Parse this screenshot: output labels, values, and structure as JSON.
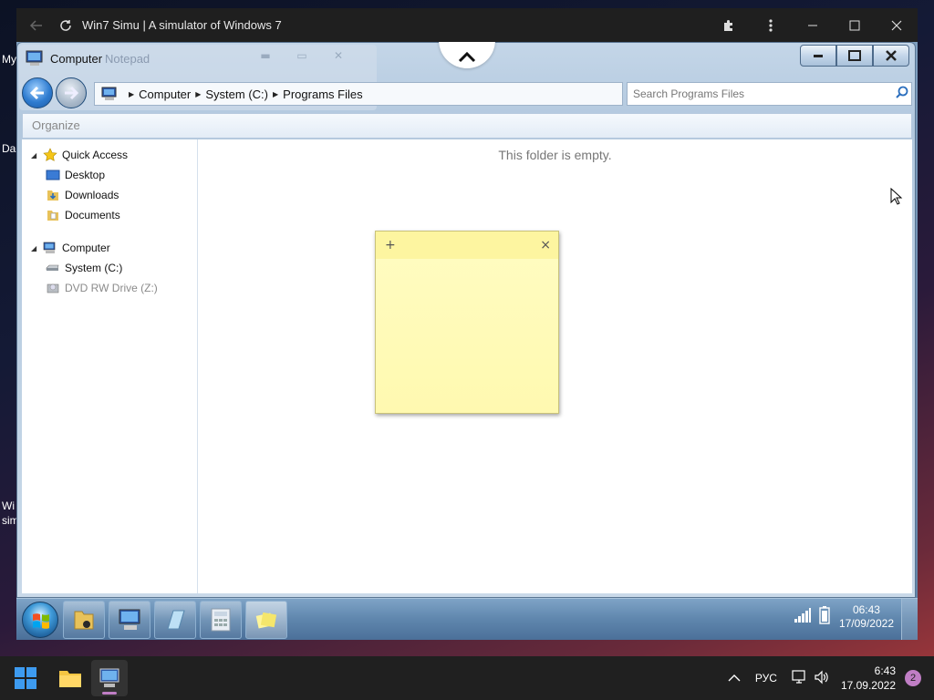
{
  "host": {
    "title": "Win7 Simu | A simulator of Windows 7",
    "icons": [
      "back-arrow-icon",
      "reload-icon",
      "extension-icon",
      "kebab-menu-icon",
      "minimize-icon",
      "maximize-icon",
      "close-icon"
    ]
  },
  "desktop_fragments": [
    "My",
    "Da",
    "Wi",
    "sim"
  ],
  "explorer": {
    "title": "Computer",
    "ghost_title": "Notepad",
    "breadcrumbs": [
      "Computer",
      "System (C:)",
      "Programs Files"
    ],
    "search_placeholder": "Search Programs Files",
    "organize_label": "Organize",
    "empty_message": "This folder is empty.",
    "nav": {
      "quick_access": {
        "label": "Quick Access",
        "children": [
          "Desktop",
          "Downloads",
          "Documents"
        ]
      },
      "computer": {
        "label": "Computer",
        "children": [
          "System (C:)",
          "DVD RW Drive (Z:)"
        ]
      }
    }
  },
  "sticky_note": {
    "add_glyph": "+",
    "close_glyph": "×"
  },
  "taskbar7": {
    "items": [
      "explorer-folder",
      "computer",
      "notepad",
      "calculator",
      "sticky-notes"
    ],
    "time": "06:43",
    "date": "17/09/2022"
  },
  "taskbar11": {
    "language": "РУС",
    "time": "6:43",
    "date": "17.09.2022",
    "notification_count": "2"
  },
  "colors": {
    "accent": "#3d9bf0",
    "sticky": "#fff9b0",
    "badge": "#c07ec5"
  }
}
